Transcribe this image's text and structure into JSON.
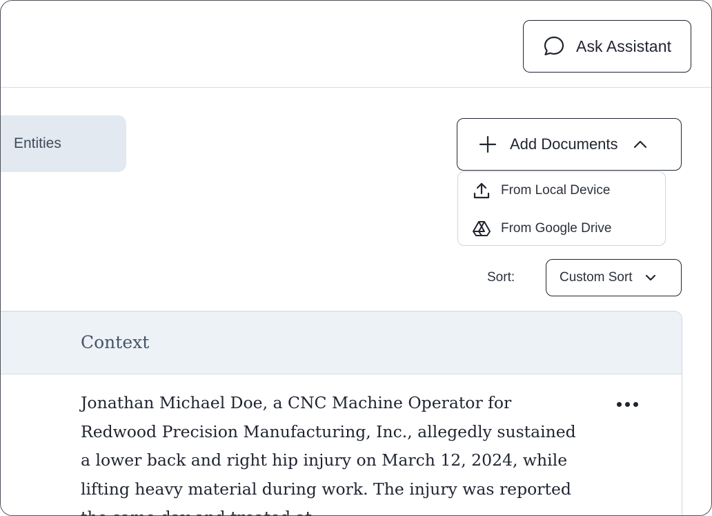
{
  "header": {
    "assistant_button": {
      "label": "Ask Assistant",
      "icon": "chat-bubble-icon"
    }
  },
  "tabs": {
    "entities": "Entities"
  },
  "add_documents": {
    "label": "Add Documents",
    "icon": "plus-icon",
    "state": "expanded",
    "menu": [
      {
        "label": "From Local Device",
        "icon": "upload-icon"
      },
      {
        "label": "From Google Drive",
        "icon": "google-drive-icon"
      }
    ]
  },
  "sort": {
    "label": "Sort:",
    "selected": "Custom Sort"
  },
  "table": {
    "columns": [
      "Context"
    ],
    "rows": [
      {
        "context": "Jonathan Michael Doe, a CNC Machine Operator for Redwood Precision Manufacturing, Inc., allegedly sustained a lower back and right hip injury on March 12, 2024, while lifting heavy material during work. The injury was reported the same day and treated at"
      }
    ]
  }
}
